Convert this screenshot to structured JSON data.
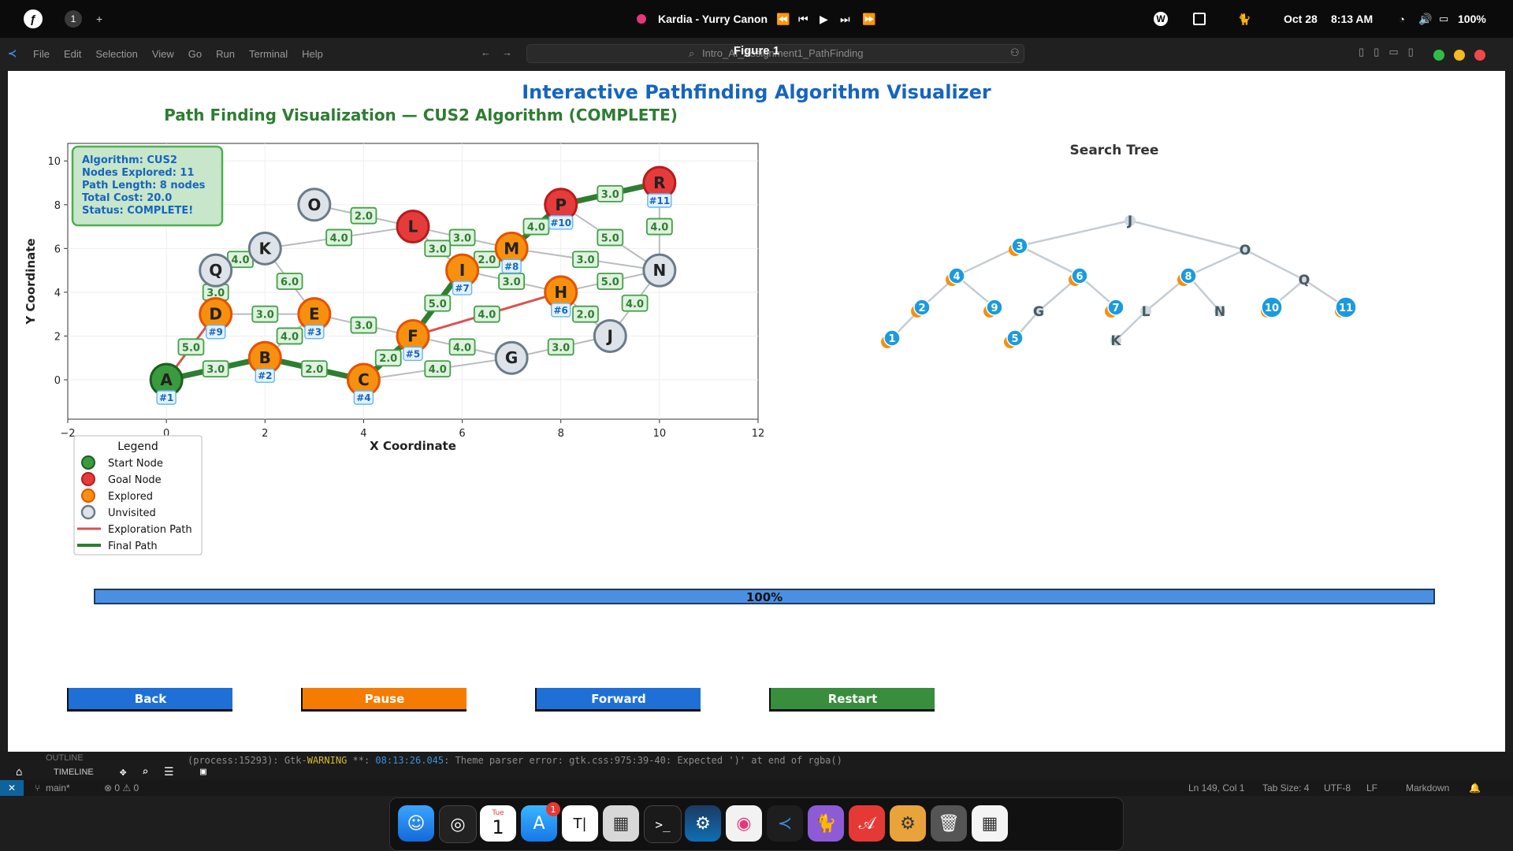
{
  "topbar": {
    "workspace": "1",
    "add": "+",
    "media_title": "Kardia - Yurry Canon",
    "date": "Oct 28",
    "time": "8:13 AM",
    "battery": "100%"
  },
  "vscode": {
    "menu": [
      "File",
      "Edit",
      "Selection",
      "View",
      "Go",
      "Run",
      "Terminal",
      "Help"
    ],
    "search_value": "Intro_AI_Assignment1_PathFinding"
  },
  "figure": {
    "window_title": "Figure 1",
    "main_title": "Interactive Pathfinding Algorithm Visualizer",
    "plot_title": "Path Finding Visualization — CUS2 Algorithm (COMPLETE)",
    "xlabel": "X Coordinate",
    "ylabel": "Y Coordinate",
    "x_ticks": [
      "−2",
      "0",
      "2",
      "4",
      "6",
      "8",
      "10",
      "12"
    ],
    "y_ticks": [
      "0",
      "2",
      "4",
      "6",
      "8",
      "10"
    ],
    "info_lines": [
      "Algorithm: CUS2",
      "Nodes Explored: 11",
      "Path Length: 8 nodes",
      "Total Cost: 20.0",
      "Status: COMPLETE!"
    ],
    "legend": {
      "title": "Legend",
      "items": [
        "Start Node",
        "Goal Node",
        "Explored",
        "Unvisited",
        "Exploration Path",
        "Final Path"
      ]
    },
    "tree_title": "Search Tree",
    "progress_label": "100%",
    "progress": 1.0,
    "buttons": {
      "back": "Back",
      "pause": "Pause",
      "forward": "Forward",
      "restart": "Restart"
    },
    "colors": {
      "start": "#3a9a3e",
      "goal": "#e63b3b",
      "explored": "#f7900f",
      "unvisited": "#dde3e9",
      "final": "#2e7d32",
      "explore_edge": "#d9534f",
      "accent": "#1565c0",
      "tree_badge": "#1a9be0"
    }
  },
  "chart_data": {
    "type": "scatter",
    "title": "Path Finding Visualization — CUS2 Algorithm (COMPLETE)",
    "xlabel": "X Coordinate",
    "ylabel": "Y Coordinate",
    "xlim": [
      -2,
      12
    ],
    "ylim": [
      -1.8,
      10.8
    ],
    "nodes": [
      {
        "id": "A",
        "x": 0,
        "y": 0,
        "state": "start",
        "order": "#1"
      },
      {
        "id": "B",
        "x": 2,
        "y": 1,
        "state": "explored",
        "order": "#2"
      },
      {
        "id": "C",
        "x": 4,
        "y": 0,
        "state": "explored",
        "order": "#4"
      },
      {
        "id": "D",
        "x": 1,
        "y": 3,
        "state": "explored",
        "order": "#9"
      },
      {
        "id": "E",
        "x": 3,
        "y": 3,
        "state": "explored",
        "order": "#3"
      },
      {
        "id": "F",
        "x": 5,
        "y": 2,
        "state": "explored",
        "order": "#5"
      },
      {
        "id": "G",
        "x": 7,
        "y": 1,
        "state": "unvisited",
        "order": ""
      },
      {
        "id": "H",
        "x": 8,
        "y": 4,
        "state": "explored",
        "order": "#6"
      },
      {
        "id": "I",
        "x": 6,
        "y": 5,
        "state": "explored",
        "order": "#7"
      },
      {
        "id": "J",
        "x": 9,
        "y": 2,
        "state": "unvisited",
        "order": ""
      },
      {
        "id": "K",
        "x": 2,
        "y": 6,
        "state": "unvisited",
        "order": ""
      },
      {
        "id": "L",
        "x": 5,
        "y": 7,
        "state": "goal",
        "order": ""
      },
      {
        "id": "M",
        "x": 7,
        "y": 6,
        "state": "explored",
        "order": "#8"
      },
      {
        "id": "N",
        "x": 10,
        "y": 5,
        "state": "unvisited",
        "order": ""
      },
      {
        "id": "O",
        "x": 3,
        "y": 8,
        "state": "unvisited",
        "order": ""
      },
      {
        "id": "P",
        "x": 8,
        "y": 8,
        "state": "goal",
        "order": "#10"
      },
      {
        "id": "Q",
        "x": 1,
        "y": 5,
        "state": "unvisited",
        "order": ""
      },
      {
        "id": "R",
        "x": 10,
        "y": 9,
        "state": "goal",
        "order": "#11"
      }
    ],
    "edges": [
      {
        "from": "A",
        "to": "D",
        "w": "5.0",
        "kind": "explore"
      },
      {
        "from": "D",
        "to": "Q",
        "w": "3.0",
        "kind": "normal"
      },
      {
        "from": "D",
        "to": "E",
        "w": "3.0",
        "kind": "normal"
      },
      {
        "from": "Q",
        "to": "K",
        "w": "4.0",
        "kind": "normal"
      },
      {
        "from": "K",
        "to": "E",
        "w": "6.0",
        "kind": "normal"
      },
      {
        "from": "K",
        "to": "L",
        "w": "4.0",
        "kind": "normal"
      },
      {
        "from": "O",
        "to": "L",
        "w": "2.0",
        "kind": "normal"
      },
      {
        "from": "L",
        "to": "M",
        "w": "3.0",
        "kind": "normal"
      },
      {
        "from": "L",
        "to": "I",
        "w": "3.0",
        "kind": "normal"
      },
      {
        "from": "B",
        "to": "E",
        "w": "4.0",
        "kind": "normal"
      },
      {
        "from": "E",
        "to": "F",
        "w": "3.0",
        "kind": "normal"
      },
      {
        "from": "F",
        "to": "H",
        "w": "4.0",
        "kind": "explore"
      },
      {
        "from": "F",
        "to": "G",
        "w": "4.0",
        "kind": "normal"
      },
      {
        "from": "C",
        "to": "G",
        "w": "4.0",
        "kind": "normal"
      },
      {
        "from": "G",
        "to": "J",
        "w": "3.0",
        "kind": "normal"
      },
      {
        "from": "I",
        "to": "H",
        "w": "3.0",
        "kind": "normal"
      },
      {
        "from": "H",
        "to": "J",
        "w": "2.0",
        "kind": "normal"
      },
      {
        "from": "H",
        "to": "N",
        "w": "5.0",
        "kind": "normal"
      },
      {
        "from": "J",
        "to": "N",
        "w": "4.0",
        "kind": "normal"
      },
      {
        "from": "M",
        "to": "N",
        "w": "3.0",
        "kind": "normal"
      },
      {
        "from": "P",
        "to": "N",
        "w": "5.0",
        "kind": "normal"
      },
      {
        "from": "R",
        "to": "N",
        "w": "4.0",
        "kind": "normal"
      },
      {
        "from": "M",
        "to": "I",
        "w": "2.0",
        "kind": "normal"
      },
      {
        "from": "A",
        "to": "B",
        "w": "3.0",
        "kind": "final"
      },
      {
        "from": "B",
        "to": "C",
        "w": "2.0",
        "kind": "final"
      },
      {
        "from": "C",
        "to": "F",
        "w": "2.0",
        "kind": "final"
      },
      {
        "from": "F",
        "to": "I",
        "w": "5.0",
        "kind": "final"
      },
      {
        "from": "I",
        "to": "M",
        "w": "2.0",
        "kind": "final"
      },
      {
        "from": "M",
        "to": "P",
        "w": "4.0",
        "kind": "final"
      },
      {
        "from": "P",
        "to": "R",
        "w": "3.0",
        "kind": "final"
      }
    ],
    "search_tree": [
      {
        "label": "J",
        "badge": false,
        "explored": false
      },
      {
        "label": "3",
        "badge": true,
        "explored": true
      },
      {
        "label": "O",
        "badge": false,
        "explored": false
      },
      {
        "label": "4",
        "badge": true,
        "explored": true
      },
      {
        "label": "6",
        "badge": true,
        "explored": true
      },
      {
        "label": "8",
        "badge": true,
        "explored": true
      },
      {
        "label": "Q",
        "badge": false,
        "explored": false
      },
      {
        "label": "2",
        "badge": true,
        "explored": true
      },
      {
        "label": "9",
        "badge": true,
        "explored": true
      },
      {
        "label": "G",
        "badge": false,
        "explored": false
      },
      {
        "label": "7",
        "badge": true,
        "explored": true
      },
      {
        "label": "L",
        "badge": false,
        "explored": false
      },
      {
        "label": "N",
        "badge": false,
        "explored": false
      },
      {
        "label": "10",
        "badge": true,
        "explored": true
      },
      {
        "label": "11",
        "badge": true,
        "explored": true
      },
      {
        "label": "1",
        "badge": true,
        "explored": true
      },
      {
        "label": "5",
        "badge": true,
        "explored": true
      },
      {
        "label": "K",
        "badge": false,
        "explored": false
      }
    ],
    "tree_edges": [
      [
        "J",
        "3"
      ],
      [
        "J",
        "O"
      ],
      [
        "3",
        "4"
      ],
      [
        "3",
        "6"
      ],
      [
        "O",
        "8"
      ],
      [
        "O",
        "Q"
      ],
      [
        "4",
        "2"
      ],
      [
        "4",
        "9"
      ],
      [
        "6",
        "G"
      ],
      [
        "6",
        "7"
      ],
      [
        "8",
        "L"
      ],
      [
        "8",
        "N"
      ],
      [
        "Q",
        "10"
      ],
      [
        "Q",
        "11"
      ],
      [
        "2",
        "1"
      ],
      [
        "G",
        "5"
      ],
      [
        "L",
        "K"
      ]
    ]
  },
  "bottom": {
    "outline_label": "OUTLINE",
    "timeline_label": "TIMELINE",
    "log_prefix": "(process:15293): Gtk-",
    "log_warning": "WARNING",
    "log_stars": " **: ",
    "log_time": "08:13:26.045",
    "log_message": ": Theme parser error: gtk.css:975:39-40: Expected ')' at end of rgba()",
    "branch": "main*",
    "problems": "⊗ 0 ⚠ 0",
    "position": "Ln 149, Col 1",
    "tab_size": "Tab Size: 4",
    "encoding": "UTF-8",
    "eol": "LF",
    "language": "Markdown"
  },
  "dock": {
    "calendar_day": "Tue",
    "calendar_date": "1",
    "appstore_badge": "1",
    "typora": "T|",
    "terminal": ">_"
  }
}
